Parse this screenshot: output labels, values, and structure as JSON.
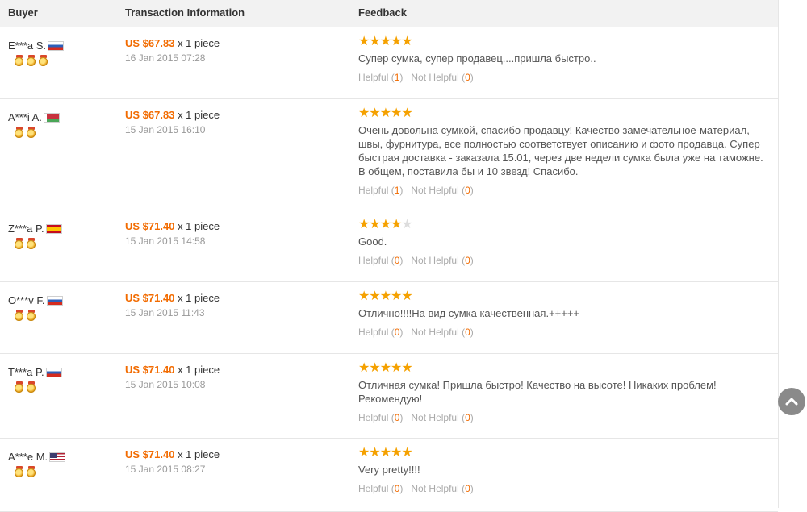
{
  "header": {
    "buyer": "Buyer",
    "transaction": "Transaction Information",
    "feedback": "Feedback"
  },
  "helpful_label": "Helpful",
  "not_helpful_label": "Not Helpful",
  "reviews": [
    {
      "buyer": "E***a S.",
      "flag": "russia",
      "medals": 3,
      "price": "US $67.83",
      "quantity": "x 1 piece",
      "date": "16 Jan 2015 07:28",
      "rating": 5,
      "text": "Супер сумка, супер продавец....пришла быстро..",
      "helpful": "1",
      "not_helpful": "0"
    },
    {
      "buyer": "A***i A.",
      "flag": "belarus",
      "medals": 2,
      "price": "US $67.83",
      "quantity": "x 1 piece",
      "date": "15 Jan 2015 16:10",
      "rating": 5,
      "text": "Очень довольна сумкой, спасибо продавцу! Качество замечательное-материал, швы, фурнитура, все полностью соответствует описанию и фото продавца. Супер быстрая доставка - заказала 15.01, через две недели сумка была уже на таможне. В общем, поставила бы и 10 звезд! Спасибо.",
      "helpful": "1",
      "not_helpful": "0"
    },
    {
      "buyer": "Z***a P.",
      "flag": "spain",
      "medals": 2,
      "price": "US $71.40",
      "quantity": "x 1 piece",
      "date": "15 Jan 2015 14:58",
      "rating": 4,
      "text": "Good.",
      "helpful": "0",
      "not_helpful": "0"
    },
    {
      "buyer": "O***v F.",
      "flag": "russia",
      "medals": 2,
      "price": "US $71.40",
      "quantity": "x 1 piece",
      "date": "15 Jan 2015 11:43",
      "rating": 5,
      "text": "Отлично!!!!На вид сумка качественная.+++++",
      "helpful": "0",
      "not_helpful": "0"
    },
    {
      "buyer": "T***a P.",
      "flag": "russia",
      "medals": 2,
      "price": "US $71.40",
      "quantity": "x 1 piece",
      "date": "15 Jan 2015 10:08",
      "rating": 5,
      "text": "Отличная сумка! Пришла быстро! Качество на высоте! Никаких проблем! Рекомендую!",
      "helpful": "0",
      "not_helpful": "0"
    },
    {
      "buyer": "A***e M.",
      "flag": "usa",
      "medals": 2,
      "price": "US $71.40",
      "quantity": "x 1 piece",
      "date": "15 Jan 2015 08:27",
      "rating": 5,
      "text": "Very pretty!!!!",
      "helpful": "0",
      "not_helpful": "0"
    }
  ],
  "colors": {
    "price": "#f26b00",
    "star": "#f5a100",
    "star_off": "#dddddd",
    "header_bg": "#f2f2f2"
  },
  "icons": {
    "scroll_top": "chevron-up-icon",
    "medal": "medal-icon",
    "star": "star-icon"
  }
}
